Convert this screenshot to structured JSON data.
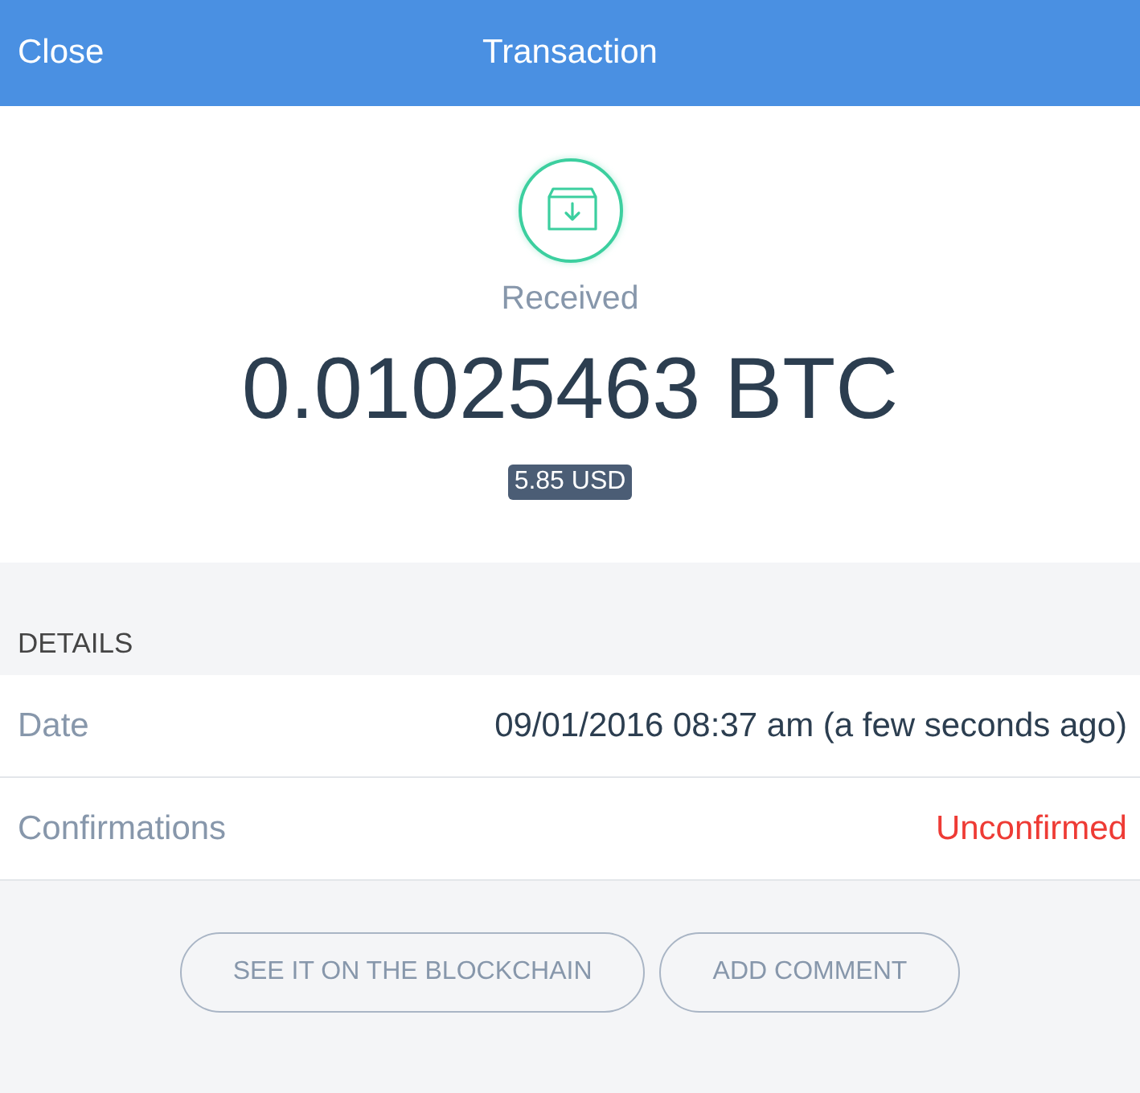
{
  "header": {
    "close": "Close",
    "title": "Transaction"
  },
  "summary": {
    "kind": "received",
    "status": "Received",
    "amount": "0.01025463 BTC",
    "fiat": "5.85 USD"
  },
  "details": {
    "heading": "DETAILS",
    "rows": [
      {
        "kind": "plain",
        "label": "Date",
        "value": "09/01/2016 08:37 am (a few seconds ago)"
      },
      {
        "kind": "alert",
        "label": "Confirmations",
        "value": "Unconfirmed"
      }
    ]
  },
  "actions": [
    "SEE IT ON THE BLOCKCHAIN",
    "ADD COMMENT"
  ]
}
